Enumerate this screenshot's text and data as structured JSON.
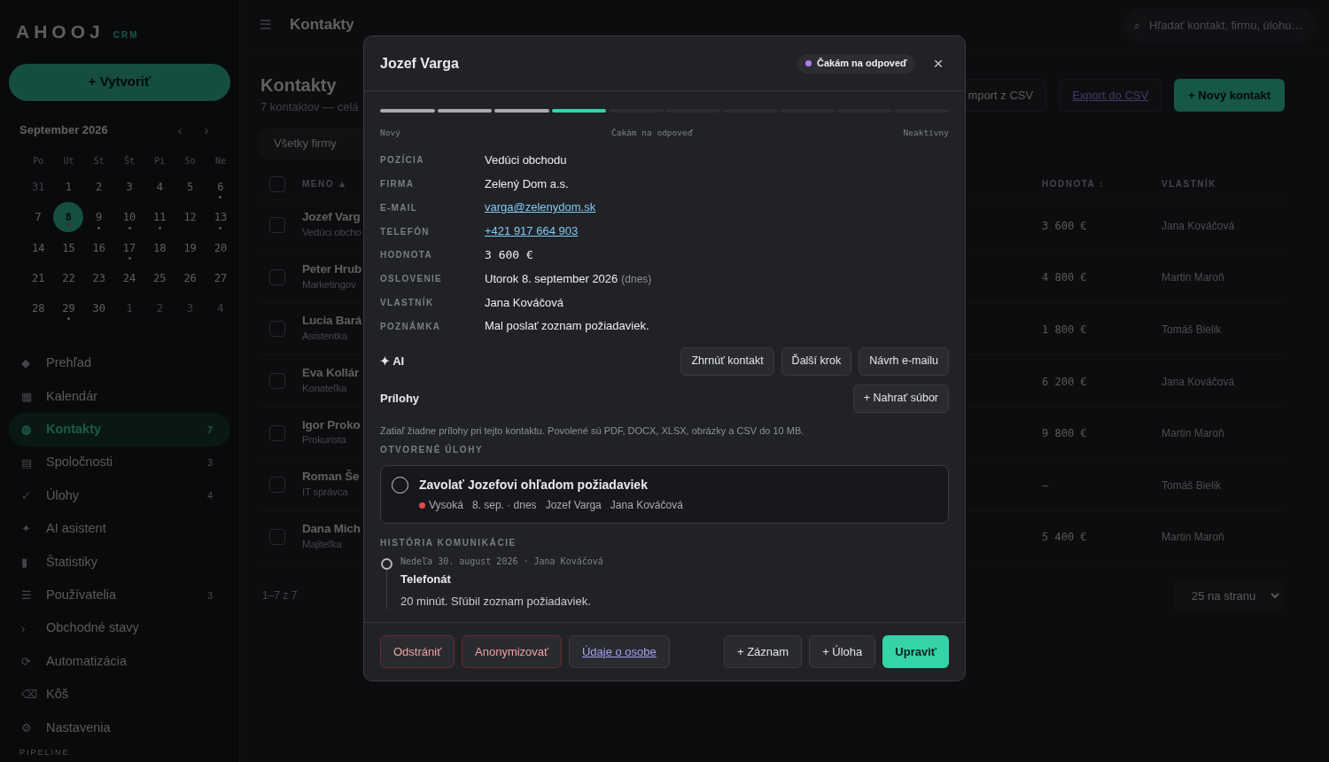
{
  "brand": {
    "name": "AHOOJ",
    "tag": "CRM"
  },
  "create_button": "+ Vytvoriť",
  "calendar": {
    "title": "September 2026",
    "prev": "‹",
    "next": "›",
    "weekdays": [
      "Po",
      "Ut",
      "St",
      "Št",
      "Pi",
      "So",
      "Ne"
    ],
    "days": [
      {
        "label": "31",
        "muted": true,
        "selected": false,
        "event": false
      },
      {
        "label": "1",
        "muted": false,
        "selected": false,
        "event": false
      },
      {
        "label": "2",
        "muted": false,
        "selected": false,
        "event": false
      },
      {
        "label": "3",
        "muted": false,
        "selected": false,
        "event": false
      },
      {
        "label": "4",
        "muted": false,
        "selected": false,
        "event": false
      },
      {
        "label": "5",
        "muted": false,
        "selected": false,
        "event": false
      },
      {
        "label": "6",
        "muted": false,
        "selected": false,
        "event": true
      },
      {
        "label": "7",
        "muted": false,
        "selected": false,
        "event": false
      },
      {
        "label": "8",
        "muted": false,
        "selected": true,
        "event": true
      },
      {
        "label": "9",
        "muted": false,
        "selected": false,
        "event": true
      },
      {
        "label": "10",
        "muted": false,
        "selected": false,
        "event": true
      },
      {
        "label": "11",
        "muted": false,
        "selected": false,
        "event": true
      },
      {
        "label": "12",
        "muted": false,
        "selected": false,
        "event": false
      },
      {
        "label": "13",
        "muted": false,
        "selected": false,
        "event": true
      },
      {
        "label": "14",
        "muted": false,
        "selected": false,
        "event": false
      },
      {
        "label": "15",
        "muted": false,
        "selected": false,
        "event": false
      },
      {
        "label": "16",
        "muted": false,
        "selected": false,
        "event": false
      },
      {
        "label": "17",
        "muted": false,
        "selected": false,
        "event": true
      },
      {
        "label": "18",
        "muted": false,
        "selected": false,
        "event": false
      },
      {
        "label": "19",
        "muted": false,
        "selected": false,
        "event": false
      },
      {
        "label": "20",
        "muted": false,
        "selected": false,
        "event": false
      },
      {
        "label": "21",
        "muted": false,
        "selected": false,
        "event": false
      },
      {
        "label": "22",
        "muted": false,
        "selected": false,
        "event": false
      },
      {
        "label": "23",
        "muted": false,
        "selected": false,
        "event": false
      },
      {
        "label": "24",
        "muted": false,
        "selected": false,
        "event": false
      },
      {
        "label": "25",
        "muted": false,
        "selected": false,
        "event": false
      },
      {
        "label": "26",
        "muted": false,
        "selected": false,
        "event": false
      },
      {
        "label": "27",
        "muted": false,
        "selected": false,
        "event": false
      },
      {
        "label": "28",
        "muted": false,
        "selected": false,
        "event": false
      },
      {
        "label": "29",
        "muted": false,
        "selected": false,
        "event": true
      },
      {
        "label": "30",
        "muted": false,
        "selected": false,
        "event": false
      },
      {
        "label": "1",
        "muted": true,
        "selected": false,
        "event": false
      },
      {
        "label": "2",
        "muted": true,
        "selected": false,
        "event": false
      },
      {
        "label": "3",
        "muted": true,
        "selected": false,
        "event": false
      },
      {
        "label": "4",
        "muted": true,
        "selected": false,
        "event": false
      }
    ]
  },
  "sidebar": {
    "items": [
      {
        "icon": "◆",
        "label": "Prehľad",
        "selected": false
      },
      {
        "icon": "▦",
        "label": "Kalendár",
        "selected": false
      },
      {
        "icon": "◍",
        "label": "Kontakty",
        "count": "7",
        "selected": true
      },
      {
        "icon": "▤",
        "label": "Spoločnosti",
        "count": "3",
        "selected": false
      },
      {
        "icon": "✓",
        "label": "Úlohy",
        "count": "4",
        "selected": false
      },
      {
        "icon": "✦",
        "label": "AI asistent",
        "selected": false
      },
      {
        "icon": "▮",
        "label": "Štatistiky",
        "selected": false
      },
      {
        "icon": "☰",
        "label": "Používatelia",
        "count": "3",
        "selected": false
      },
      {
        "icon": "›",
        "label": "Obchodné stavy",
        "selected": false
      },
      {
        "icon": "⟳",
        "label": "Automatizácia",
        "selected": false
      },
      {
        "icon": "⌫",
        "label": "Kôš",
        "selected": false
      },
      {
        "icon": "⚙",
        "label": "Nastavenia",
        "selected": false
      }
    ],
    "section": "PIPELINE"
  },
  "topbar": {
    "menu_icon": "☰",
    "title": "Kontakty",
    "search_icon": "⌕",
    "search_placeholder": "Hľadať kontakt, firmu, úlohu…"
  },
  "page": {
    "title": "Kontakty",
    "subtitle": "7 kontaktov — celá",
    "actions": [
      {
        "label": "mport z CSV",
        "kind": "outline"
      },
      {
        "label": "Export do CSV",
        "kind": "link"
      },
      {
        "label": "+ Nový kontakt",
        "kind": "primary"
      }
    ],
    "filter": "Všetky firmy"
  },
  "table": {
    "select_all": false,
    "columns": [
      {
        "label": "MENO",
        "sort": "▲"
      },
      {
        "label": "HODNOTA",
        "sort": "↕"
      },
      {
        "label": "VLASTNÍK"
      }
    ],
    "rows": [
      {
        "checked": false,
        "name": "Jozef Varg",
        "role": "Vedúci obcho",
        "value": "3 600 €",
        "owner": "Jana Kováčová"
      },
      {
        "checked": false,
        "name": "Peter Hrub",
        "role": "Marketingov",
        "value": "4 800 €",
        "owner": "Martin Maroň"
      },
      {
        "checked": false,
        "name": "Lucia Bará",
        "role": "Asistentka",
        "value": "1 800 €",
        "owner": "Tomáš Bielik"
      },
      {
        "checked": false,
        "name": "Eva Kollár",
        "role": "Konateľka",
        "value": "6 200 €",
        "owner": "Jana Kováčová"
      },
      {
        "checked": false,
        "name": "Igor Proko",
        "role": "Prokurista",
        "value": "9 800 €",
        "owner": "Martin Maroň"
      },
      {
        "checked": false,
        "name": "Roman Še",
        "role": "IT správca",
        "value": "–",
        "owner": "Tomáš Bielik"
      },
      {
        "checked": false,
        "name": "Dana Mich",
        "role": "Majiteľka",
        "value": "5 400 €",
        "owner": "Martin Maroň"
      }
    ],
    "pagination": "1–7 z 7",
    "page_size": "25 na stranu"
  },
  "modal": {
    "title": "Jozef Varga",
    "status": {
      "label": "Čakám na odpoveď",
      "color": "#b07cf0"
    },
    "close": "×",
    "progress": [
      {
        "done": true,
        "active": false
      },
      {
        "done": true,
        "active": false
      },
      {
        "done": true,
        "active": false
      },
      {
        "done": false,
        "active": true
      },
      {
        "done": false,
        "active": false
      },
      {
        "done": false,
        "active": false
      },
      {
        "done": false,
        "active": false
      },
      {
        "done": false,
        "active": false
      },
      {
        "done": false,
        "active": false
      },
      {
        "done": false,
        "active": false
      }
    ],
    "progress_labels": [
      "Nový",
      "Čakám na odpoveď",
      "Neaktívny"
    ],
    "fields": [
      {
        "label": "POZÍCIA",
        "value": "Vedúci obchodu",
        "kind": "text"
      },
      {
        "label": "FIRMA",
        "value": "Zelený Dom a.s.",
        "kind": "text"
      },
      {
        "label": "E-MAIL",
        "value": "varga@zelenydom.sk",
        "kind": "link"
      },
      {
        "label": "TELEFÓN",
        "value": "+421 917 664 903",
        "kind": "link"
      },
      {
        "label": "HODNOTA",
        "value": "3 600 €",
        "kind": "mono"
      },
      {
        "label": "OSLOVENIE",
        "value": "Utorok 8. september 2026",
        "note": "(dnes)",
        "kind": "text"
      },
      {
        "label": "VLASTNÍK",
        "value": "Jana Kováčová",
        "kind": "text"
      },
      {
        "label": "POZNÁMKA",
        "value": "Mal poslať zoznam požiadaviek.",
        "kind": "text"
      }
    ],
    "ai": {
      "label": "✦ AI",
      "buttons": [
        "Zhrnúť kontakt",
        "Ďalší krok",
        "Návrh e-mailu"
      ]
    },
    "attachments": {
      "title": "Prílohy",
      "button": "+ Nahrať súbor",
      "hint": "Zatiaľ žiadne prílohy pri tejto kontaktu. Povolené sú PDF, DOCX, XLSX, obrázky a CSV do 10 MB."
    },
    "tasks": {
      "title": "OTVORENÉ ÚLOHY",
      "items": [
        {
          "title": "Zavolať Jozefovi ohľadom požiadaviek",
          "done": false,
          "priority": "Vysoká",
          "color": "#e5484d",
          "due": "8. sep. · dnes",
          "contact": "Jozef Varga",
          "owner": "Jana Kováčová"
        }
      ]
    },
    "history": {
      "title": "HISTÓRIA KOMUNIKÁCIE",
      "items": [
        {
          "meta": "Nedeľa 30. august 2026 · Jana Kováčová",
          "title": "Telefonát",
          "text": "20 minút. Sľúbil zoznam požiadaviek."
        }
      ]
    },
    "footer": [
      {
        "label": "Odstrániť",
        "kind": "danger"
      },
      {
        "label": "Anonymizovať",
        "kind": "danger"
      },
      {
        "label": "Údaje o osobe",
        "kind": "link"
      },
      {
        "label": "+ Záznam",
        "kind": "plain"
      },
      {
        "label": "+ Úloha",
        "kind": "plain"
      },
      {
        "label": "Upraviť",
        "kind": "primary"
      }
    ]
  }
}
